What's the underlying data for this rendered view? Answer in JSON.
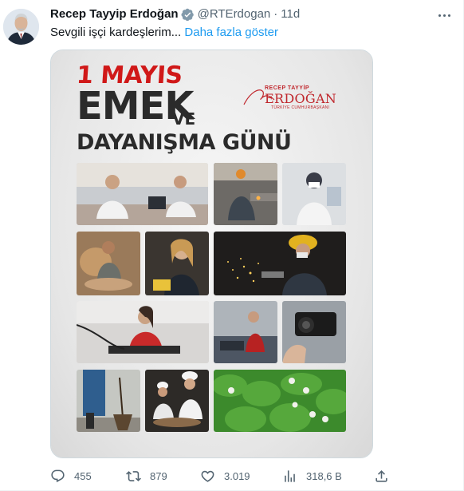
{
  "tweet": {
    "author_name": "Recep Tayyip Erdoğan",
    "handle": "@RTErdogan",
    "separator": "·",
    "time": "11d",
    "text": "Sevgili işçi kardeşlerim...",
    "show_more": "Daha fazla göster"
  },
  "poster": {
    "headline_date": "1 MAYIS",
    "headline_main": "EMEK",
    "headline_ve": "VE",
    "headline_sub": "DAYANIŞMA GÜNÜ",
    "signature_small": "RECEP TAYYİP",
    "signature_name": "ERDOĞAN",
    "signature_title": "TÜRKİYE CUMHURBAŞKANI",
    "colors": {
      "accent_red": "#d01818",
      "text_dark": "#2b2b2b"
    }
  },
  "actions": {
    "replies": "455",
    "retweets": "879",
    "likes": "3.019",
    "views": "318,6 B"
  },
  "icons": [
    "verified-icon",
    "more-icon",
    "reply-icon",
    "retweet-icon",
    "like-icon",
    "views-icon",
    "share-icon"
  ],
  "colors": {
    "link": "#1d9bf0",
    "muted": "#536471",
    "text": "#0f1419"
  }
}
